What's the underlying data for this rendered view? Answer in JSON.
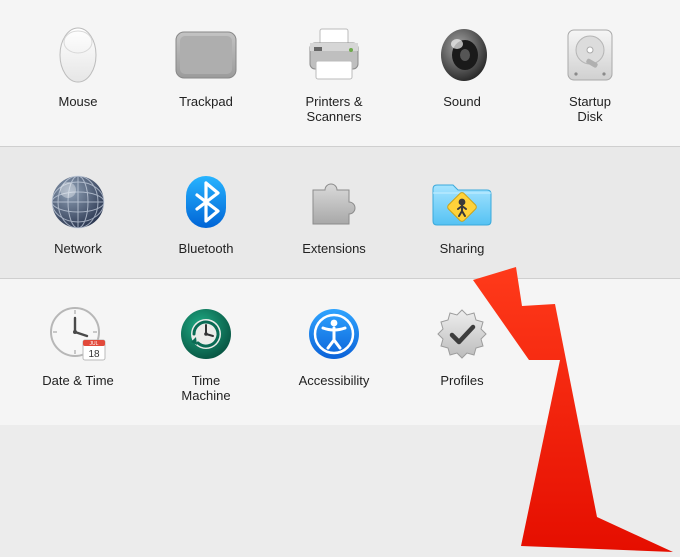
{
  "rows": [
    {
      "tone": "light",
      "items": [
        {
          "id": "mouse",
          "label": "Mouse",
          "icon": "mouse-icon"
        },
        {
          "id": "trackpad",
          "label": "Trackpad",
          "icon": "trackpad-icon"
        },
        {
          "id": "printers",
          "label": "Printers &\nScanners",
          "icon": "printer-icon"
        },
        {
          "id": "sound",
          "label": "Sound",
          "icon": "speaker-icon"
        },
        {
          "id": "startup",
          "label": "Startup\nDisk",
          "icon": "disk-icon"
        }
      ]
    },
    {
      "tone": "dark",
      "items": [
        {
          "id": "network",
          "label": "Network",
          "icon": "globe-icon"
        },
        {
          "id": "bluetooth",
          "label": "Bluetooth",
          "icon": "bluetooth-icon"
        },
        {
          "id": "extensions",
          "label": "Extensions",
          "icon": "puzzle-icon"
        },
        {
          "id": "sharing",
          "label": "Sharing",
          "icon": "sharing-folder-icon"
        }
      ]
    },
    {
      "tone": "light",
      "items": [
        {
          "id": "datetime",
          "label": "Date & Time",
          "icon": "clock-icon"
        },
        {
          "id": "timemachine",
          "label": "Time\nMachine",
          "icon": "timemachine-icon"
        },
        {
          "id": "accessibility",
          "label": "Accessibility",
          "icon": "accessibility-icon"
        },
        {
          "id": "profiles",
          "label": "Profiles",
          "icon": "badge-check-icon"
        }
      ]
    }
  ],
  "annotation": {
    "type": "arrow",
    "target": "sharing",
    "color": "#ff1a00"
  }
}
